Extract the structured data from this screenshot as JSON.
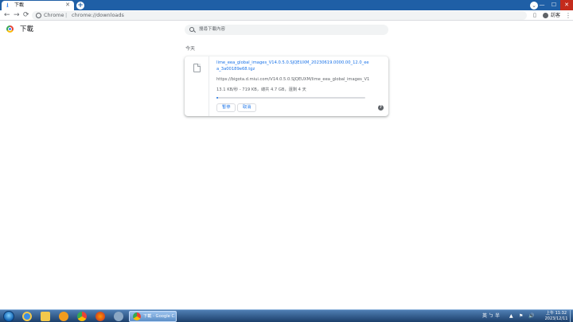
{
  "tab": {
    "title": "下載",
    "close_glyph": "✕"
  },
  "new_tab_glyph": "+",
  "tab_search_glyph": "⌄",
  "window_controls": {
    "minimize": "—",
    "maximize": "☐",
    "close": "✕"
  },
  "toolbar": {
    "back_glyph": "←",
    "forward_glyph": "→",
    "reload_glyph": "⟳",
    "url_scheme": "Chrome",
    "url_separator": "|",
    "url_path": "chrome://downloads",
    "sidepanel_glyph": "▯",
    "profile_label": "訪客",
    "menu_glyph": "⋮"
  },
  "page": {
    "title": "下載",
    "search_placeholder": "搜尋下載內容",
    "date_header": "今天"
  },
  "download": {
    "filename": "lime_eea_global_images_V14.0.5.0.SJQEUXM_20230619.0000.00_12.0_eea_3a00189e68.tgz",
    "source_url": "https://bigota.d.miui.com/V14.0.5.0.SJQEUXM/lime_eea_global_images_V14.0.5.0...",
    "status": "13.1 KB/秒 - 719 KB，總共 4.7 GB，還剩 4 天",
    "progress_percent": 0.5,
    "pause_label": "暫停",
    "cancel_label": "取消",
    "help_glyph": "?"
  },
  "taskbar": {
    "active_label": "下載 - Google C...",
    "tray": [
      "英",
      "ㄅ",
      "半",
      "▲",
      "⚑",
      "🔊"
    ],
    "time": "上午 11:32",
    "date": "2023/12/11"
  }
}
